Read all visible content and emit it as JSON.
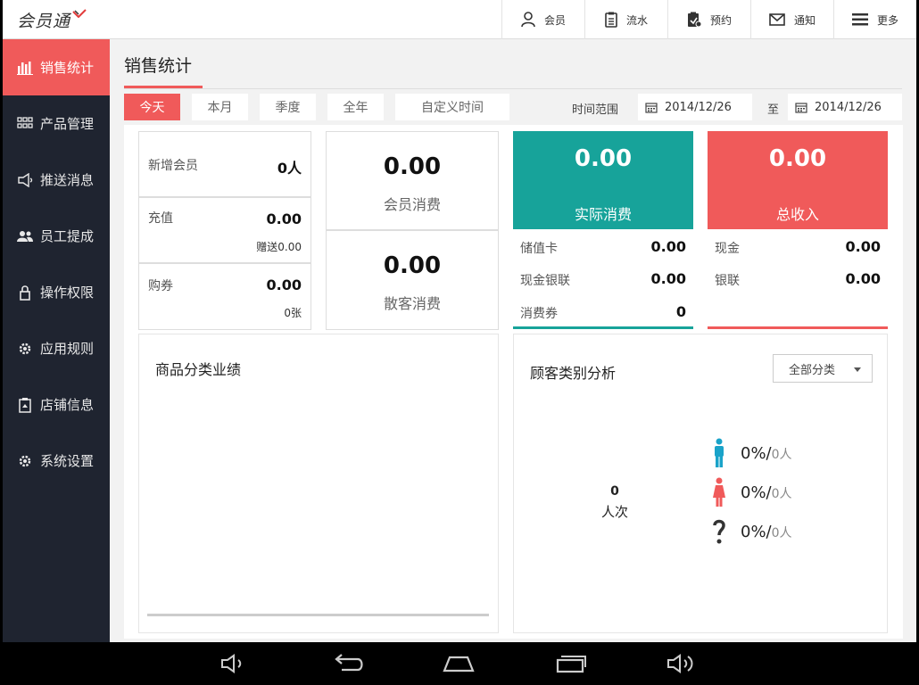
{
  "app": {
    "logo_text": "会员通",
    "accent_color": "#f05a5a",
    "teal_color": "#17a39a"
  },
  "topnav": [
    {
      "label": "会员",
      "icon": "user-icon"
    },
    {
      "label": "流水",
      "icon": "clipboard-icon"
    },
    {
      "label": "预约",
      "icon": "clipboard-check-icon"
    },
    {
      "label": "通知",
      "icon": "envelope-icon"
    },
    {
      "label": "更多",
      "icon": "menu-icon"
    }
  ],
  "sidebar": {
    "items": [
      {
        "label": "销售统计",
        "icon": "bar-chart-icon",
        "active": true
      },
      {
        "label": "产品管理",
        "icon": "grid-icon"
      },
      {
        "label": "推送消息",
        "icon": "megaphone-icon"
      },
      {
        "label": "员工提成",
        "icon": "people-icon"
      },
      {
        "label": "操作权限",
        "icon": "lock-icon"
      },
      {
        "label": "应用规则",
        "icon": "gear-icon"
      },
      {
        "label": "店铺信息",
        "icon": "store-icon"
      },
      {
        "label": "系统设置",
        "icon": "settings-icon"
      }
    ]
  },
  "main": {
    "title": "销售统计",
    "filters": [
      {
        "label": "今天",
        "active": true
      },
      {
        "label": "本月"
      },
      {
        "label": "季度"
      },
      {
        "label": "全年"
      },
      {
        "label": "自定义时间"
      }
    ],
    "range_label": "时间范围",
    "date_from": "2014/12/26",
    "to_label": "至",
    "date_to": "2014/12/26"
  },
  "stats": {
    "new_members": {
      "label": "新增会员",
      "value": "0人"
    },
    "recharge": {
      "label": "充值",
      "value": "0.00",
      "sub": "赠送0.00"
    },
    "coupons": {
      "label": "购券",
      "value": "0.00",
      "sub": "0张"
    },
    "member_spend": {
      "label": "会员消费",
      "value": "0.00"
    },
    "guest_spend": {
      "label": "散客消费",
      "value": "0.00"
    },
    "actual_spend": {
      "label": "实际消费",
      "value": "0.00",
      "rows": [
        {
          "label": "储值卡",
          "value": "0.00"
        },
        {
          "label": "现金银联",
          "value": "0.00"
        },
        {
          "label": "消费券",
          "value": "0"
        }
      ]
    },
    "total_income": {
      "label": "总收入",
      "value": "0.00",
      "rows": [
        {
          "label": "现金",
          "value": "0.00"
        },
        {
          "label": "银联",
          "value": "0.00"
        }
      ]
    }
  },
  "category_section": {
    "title": "商品分类业绩"
  },
  "customer_section": {
    "title": "顾客类别分析",
    "dropdown_value": "全部分类",
    "center_count": "0",
    "center_unit": "人次",
    "legend": [
      {
        "icon": "male-icon",
        "percent": "0%/",
        "count": "0人",
        "color": "#1aa3c9"
      },
      {
        "icon": "female-icon",
        "percent": "0%/",
        "count": "0人",
        "color": "#f05a5a"
      },
      {
        "icon": "question-icon",
        "percent": "0%/",
        "count": "0人",
        "color": "#333333"
      }
    ]
  }
}
